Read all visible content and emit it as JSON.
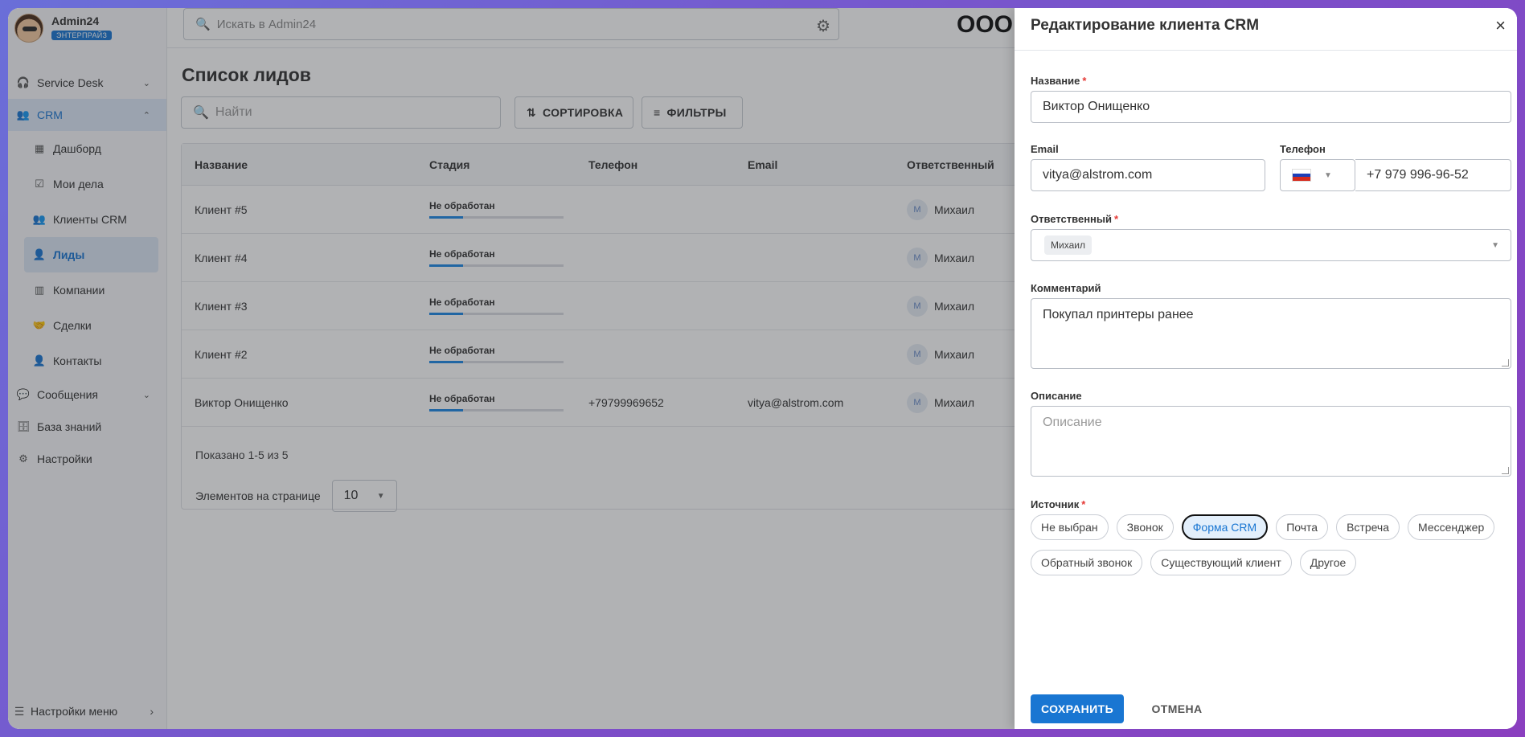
{
  "brand": {
    "name": "Admin24",
    "badge": "ЭНТЕРПРАЙЗ"
  },
  "sidebar": {
    "items": [
      {
        "label": "Service Desk",
        "icon": "headset-icon"
      },
      {
        "label": "CRM",
        "icon": "people-icon"
      },
      {
        "label": "Дашборд",
        "icon": "dashboard-icon"
      },
      {
        "label": "Мои дела",
        "icon": "calendar-check-icon"
      },
      {
        "label": "Клиенты CRM",
        "icon": "people-icon"
      },
      {
        "label": "Лиды",
        "icon": "person-icon"
      },
      {
        "label": "Компании",
        "icon": "building-icon"
      },
      {
        "label": "Сделки",
        "icon": "handshake-icon"
      },
      {
        "label": "Контакты",
        "icon": "person-icon"
      },
      {
        "label": "Сообщения",
        "icon": "message-icon"
      },
      {
        "label": "База знаний",
        "icon": "database-icon"
      },
      {
        "label": "Настройки",
        "icon": "gear-icon"
      }
    ],
    "menu_settings": "Настройки меню"
  },
  "topbar": {
    "search_placeholder": "Искать в Admin24",
    "company": "ООО \""
  },
  "leads": {
    "title": "Список лидов",
    "search_placeholder": "Найти",
    "sort_label": "СОРТИРОВКА",
    "filter_label": "ФИЛЬТРЫ",
    "columns": [
      "Название",
      "Стадия",
      "Телефон",
      "Email",
      "Ответственный"
    ],
    "rows": [
      {
        "name": "Клиент #5",
        "stage": "Не обработан",
        "stage_progress": 0.25,
        "phone": "",
        "email": "",
        "owner_initial": "М",
        "owner": "Михаил"
      },
      {
        "name": "Клиент #4",
        "stage": "Не обработан",
        "stage_progress": 0.25,
        "phone": "",
        "email": "",
        "owner_initial": "М",
        "owner": "Михаил"
      },
      {
        "name": "Клиент #3",
        "stage": "Не обработан",
        "stage_progress": 0.25,
        "phone": "",
        "email": "",
        "owner_initial": "М",
        "owner": "Михаил"
      },
      {
        "name": "Клиент #2",
        "stage": "Не обработан",
        "stage_progress": 0.25,
        "phone": "",
        "email": "",
        "owner_initial": "М",
        "owner": "Михаил"
      },
      {
        "name": "Виктор Онищенко",
        "stage": "Не обработан",
        "stage_progress": 0.25,
        "phone": "+79799969652",
        "email": "vitya@alstrom.com",
        "owner_initial": "М",
        "owner": "Михаил"
      }
    ],
    "shown": "Показано 1-5 из 5",
    "per_page_label": "Элементов на странице",
    "per_page_value": "10"
  },
  "drawer": {
    "title": "Редактирование клиента CRM",
    "name_label": "Название",
    "name_value": "Виктор Онищенко",
    "email_label": "Email",
    "email_value": "vitya@alstrom.com",
    "phone_label": "Телефон",
    "phone_value": "+7 979 996-96-52",
    "owner_label": "Ответственный",
    "owner_value": "Михаил",
    "comment_label": "Комментарий",
    "comment_value": "Покупал принтеры ранее",
    "description_label": "Описание",
    "description_placeholder": "Описание",
    "source_label": "Источник",
    "sources": [
      {
        "label": "Не выбран",
        "selected": false
      },
      {
        "label": "Звонок",
        "selected": false
      },
      {
        "label": "Форма CRM",
        "selected": true
      },
      {
        "label": "Почта",
        "selected": false
      },
      {
        "label": "Встреча",
        "selected": false
      },
      {
        "label": "Мессенджер",
        "selected": false
      },
      {
        "label": "Обратный звонок",
        "selected": false
      },
      {
        "label": "Существующий клиент",
        "selected": false
      },
      {
        "label": "Другое",
        "selected": false
      }
    ],
    "save_label": "СОХРАНИТЬ",
    "cancel_label": "ОТМЕНА"
  },
  "colors": {
    "accent": "#1976d2",
    "required": "#e53935"
  }
}
